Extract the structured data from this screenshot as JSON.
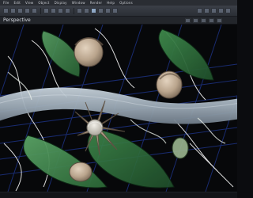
{
  "top_menu": {
    "items": [
      "File",
      "Edit",
      "View",
      "Object",
      "Display",
      "Window",
      "Render",
      "Help",
      "Options"
    ]
  },
  "toolbar": {
    "buttons": [
      "arrow",
      "select",
      "move",
      "rotate",
      "scale",
      "magnet",
      "knife",
      "paint",
      "camera",
      "render",
      "settings",
      "light",
      "grid",
      "layers",
      "zoom"
    ]
  },
  "viewport": {
    "title": "Perspective"
  },
  "colors": {
    "chrome": "#2a2d33",
    "viewport_bg": "#07080a",
    "grid": "#1b2f7a",
    "wireframe": "#ffffff",
    "leaf": "#2d6a36",
    "branch": "#a9b7c3",
    "petal": "#b9a48c"
  }
}
